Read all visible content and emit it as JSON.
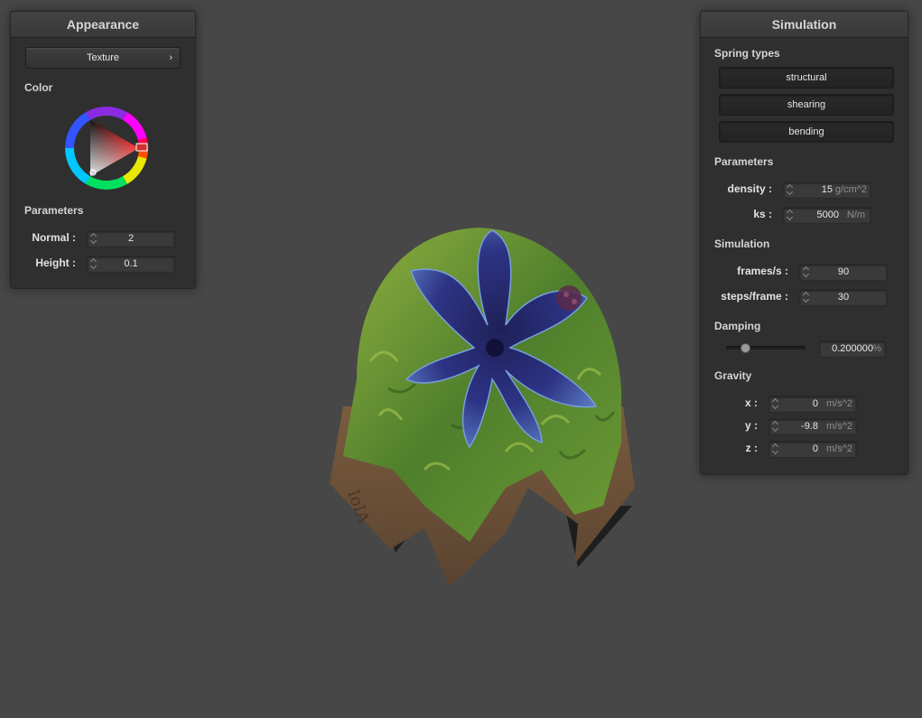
{
  "appearance": {
    "title": "Appearance",
    "texture_button": "Texture",
    "color_label": "Color",
    "parameters_label": "Parameters",
    "normal_label": "Normal :",
    "normal_value": "2",
    "height_label": "Height :",
    "height_value": "0.1",
    "color_wheel": {
      "hue_marker_color": "#ff0000",
      "triangle_color": "#ff0000"
    }
  },
  "simulation": {
    "title": "Simulation",
    "spring_types_label": "Spring types",
    "spring_types": [
      "structural",
      "shearing",
      "bending"
    ],
    "parameters_label": "Parameters",
    "density_label": "density :",
    "density_value": "15",
    "density_unit": "g/cm^2",
    "ks_label": "ks :",
    "ks_value": "5000",
    "ks_unit": "N/m",
    "simulation_label": "Simulation",
    "fps_label": "frames/s :",
    "fps_value": "90",
    "steps_label": "steps/frame :",
    "steps_value": "30",
    "damping_label": "Damping",
    "damping_value": "0.200000",
    "damping_unit": "%",
    "damping_fraction": 0.2,
    "gravity_label": "Gravity",
    "gx_label": "x :",
    "gx_value": "0",
    "gy_label": "y :",
    "gy_value": "-9.8",
    "gz_label": "z :",
    "gz_value": "0",
    "gravity_unit": "m/s^2"
  },
  "scene": {
    "background_color": "#474747",
    "object": "textured cloth draped over sphere"
  }
}
